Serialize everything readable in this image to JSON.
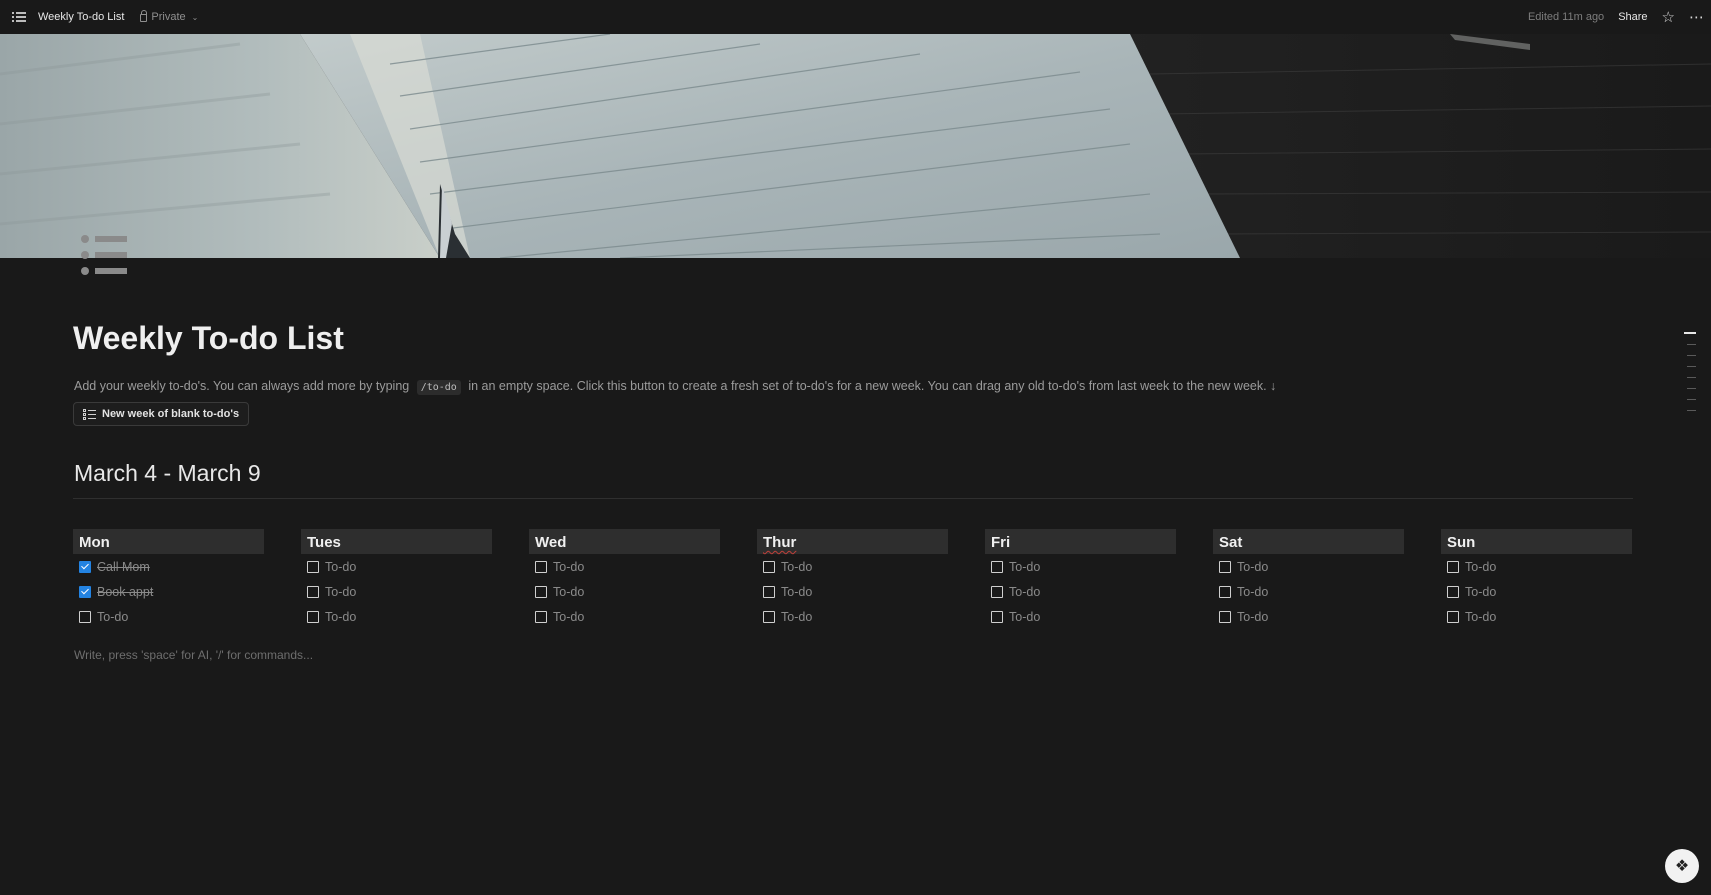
{
  "topbar": {
    "title": "Weekly To-do List",
    "privacy": "Private",
    "edited": "Edited 11m ago",
    "share": "Share",
    "icons": [
      "menu-icon",
      "lock-icon",
      "chevron-down-icon",
      "star-icon",
      "more-icon"
    ]
  },
  "page": {
    "title": "Weekly To-do List",
    "description_before": "Add your weekly to-do's. You can always add more by typing",
    "description_code": "/to-do",
    "description_after": "in an empty space. Click this button to create a fresh set of to-do's for a new week. You can drag any old to-do's from last week to the new week. ↓",
    "template_button": "New week of blank to-do's",
    "week_heading": "March 4 - March 9",
    "placeholder": "Write, press 'space' for AI, '/' for commands..."
  },
  "days": [
    {
      "name": "Mon",
      "items": [
        {
          "text": "Call Mom",
          "checked": true
        },
        {
          "text": "Book appt",
          "checked": true
        },
        {
          "text": "To-do",
          "checked": false
        }
      ]
    },
    {
      "name": "Tues",
      "items": [
        {
          "text": "To-do",
          "checked": false
        },
        {
          "text": "To-do",
          "checked": false
        },
        {
          "text": "To-do",
          "checked": false
        }
      ]
    },
    {
      "name": "Wed",
      "items": [
        {
          "text": "To-do",
          "checked": false
        },
        {
          "text": "To-do",
          "checked": false
        },
        {
          "text": "To-do",
          "checked": false
        }
      ]
    },
    {
      "name": "Thur",
      "items": [
        {
          "text": "To-do",
          "checked": false
        },
        {
          "text": "To-do",
          "checked": false
        },
        {
          "text": "To-do",
          "checked": false
        }
      ]
    },
    {
      "name": "Fri",
      "items": [
        {
          "text": "To-do",
          "checked": false
        },
        {
          "text": "To-do",
          "checked": false
        },
        {
          "text": "To-do",
          "checked": false
        }
      ]
    },
    {
      "name": "Sat",
      "items": [
        {
          "text": "To-do",
          "checked": false
        },
        {
          "text": "To-do",
          "checked": false
        },
        {
          "text": "To-do",
          "checked": false
        }
      ]
    },
    {
      "name": "Sun",
      "items": [
        {
          "text": "To-do",
          "checked": false
        },
        {
          "text": "To-do",
          "checked": false
        },
        {
          "text": "To-do",
          "checked": false
        }
      ]
    }
  ],
  "colors": {
    "background": "#191919",
    "checkbox_checked": "#2383e2",
    "column_header_bg": "#2e2e2e"
  }
}
